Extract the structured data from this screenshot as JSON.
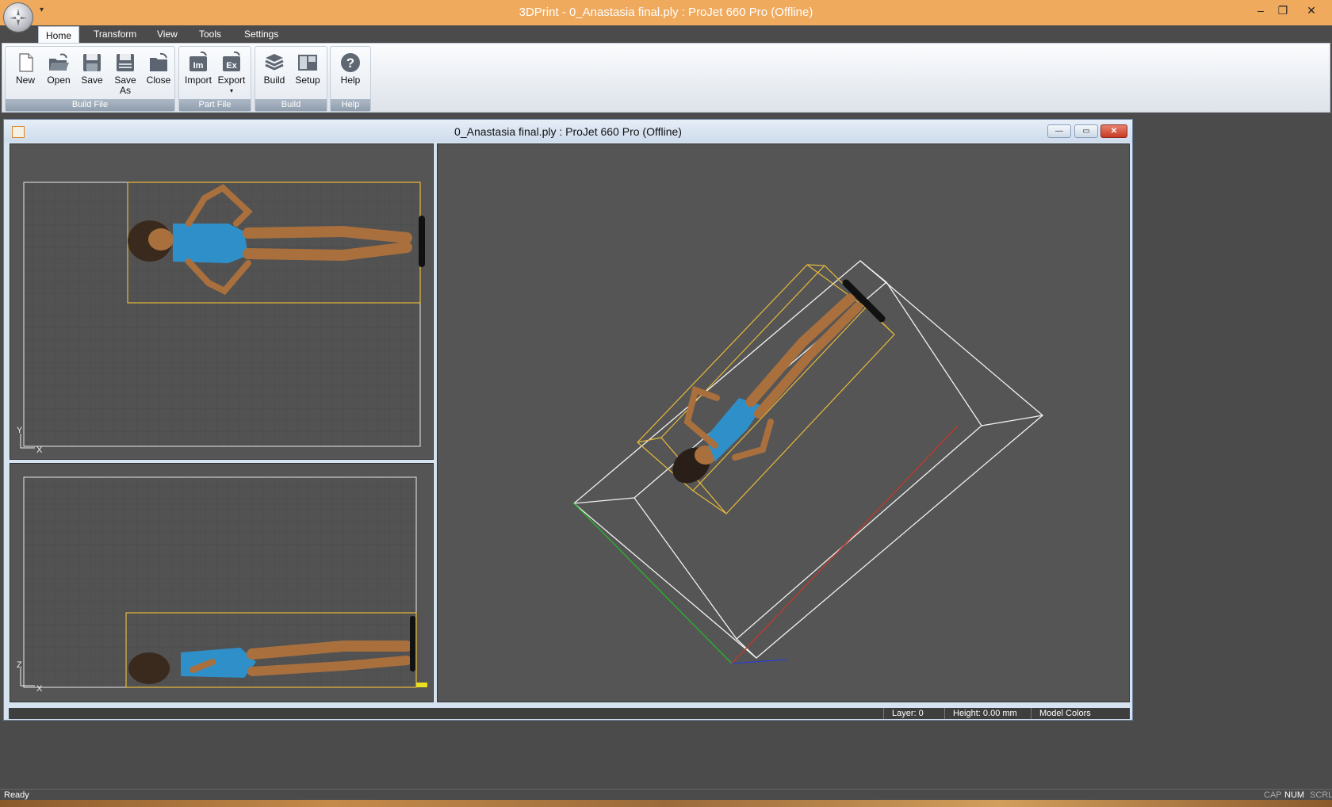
{
  "window": {
    "title": "3DPrint - 0_Anastasia final.ply : ProJet 660 Pro (Offline)",
    "qat_arrow": "▾",
    "minimize": "–",
    "restore": "❐",
    "close": "✕"
  },
  "tabs": [
    {
      "label": "Home"
    },
    {
      "label": "Transform"
    },
    {
      "label": "View"
    },
    {
      "label": "Tools"
    },
    {
      "label": "Settings"
    }
  ],
  "ribbon": {
    "groups": {
      "build_file": "Build File",
      "part_file": "Part File",
      "build": "Build",
      "help": "Help"
    },
    "buttons": {
      "new": "New",
      "open": "Open",
      "save": "Save",
      "save_as_1": "Save",
      "save_as_2": "As",
      "close": "Close",
      "import": "Import",
      "export": "Export",
      "build": "Build",
      "setup": "Setup",
      "help": "Help"
    },
    "icon_text": {
      "import": "Im",
      "export": "Ex",
      "help": "?"
    }
  },
  "document": {
    "title": "0_Anastasia final.ply : ProJet 660 Pro (Offline)",
    "min": "—",
    "restore": "▭",
    "close": "✕",
    "top_view_axes": {
      "y": "Y",
      "x": "X"
    },
    "front_view_axes": {
      "z": "Z",
      "x": "X"
    },
    "status": {
      "layer": "Layer: 0",
      "height": "Height: 0.00 mm",
      "colors": "Model Colors"
    }
  },
  "statusbar": {
    "ready": "Ready",
    "cap": "CAP",
    "num": "NUM",
    "scrl": "SCRL"
  },
  "colors": {
    "title_bar": "#efaa5e",
    "build_box_yellow": "#e8b93a",
    "skin": "#a9703e",
    "swimsuit": "#2f8fc9",
    "axis_x": "#c0392b",
    "axis_y": "#27b52c",
    "axis_z": "#2b3fd0"
  }
}
